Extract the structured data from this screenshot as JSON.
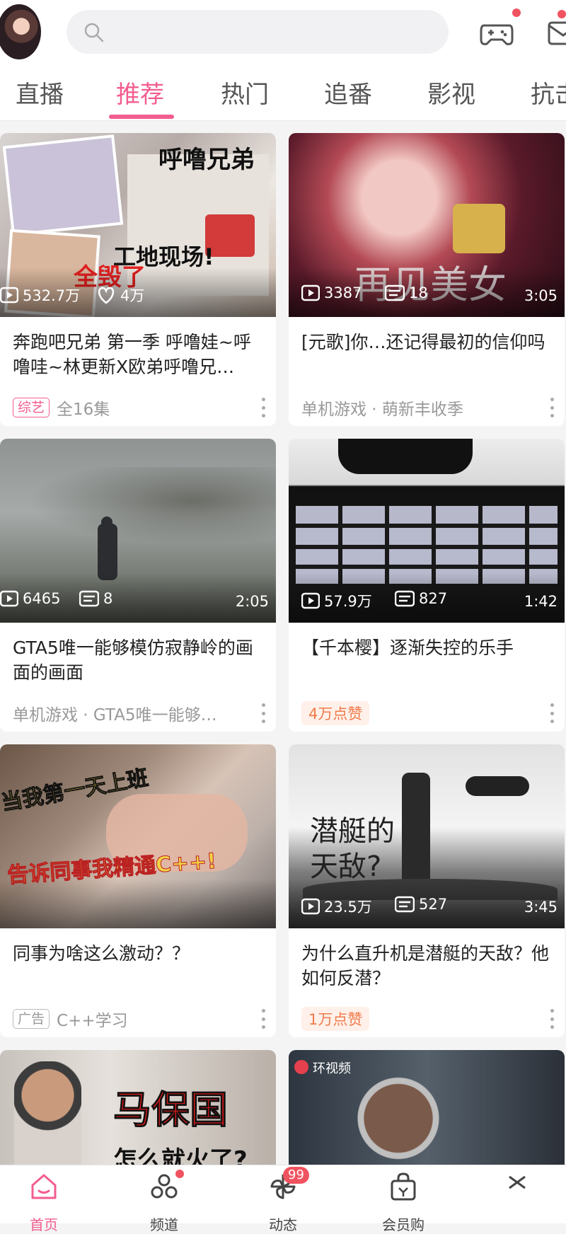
{
  "colors": {
    "accent": "#f25d8e",
    "bg": "#f4f4f4",
    "red_dot": "#f0535f"
  },
  "header": {
    "avatar": "user-avatar",
    "search_placeholder": "",
    "icons": [
      "game-controller-icon",
      "mail-icon"
    ]
  },
  "tabs": [
    "直播",
    "推荐",
    "热门",
    "追番",
    "影视",
    "抗击"
  ],
  "active_tab": "推荐",
  "cards": [
    {
      "thumb_text": [
        "呼噜兄弟",
        "工地现场!",
        "全毁了"
      ],
      "play_count": "532.7万",
      "second_stat": "4万",
      "duration": "",
      "title": "奔跑吧兄弟 第一季 呼噜娃~呼噜哇~林更新X欧弟呼噜兄…",
      "badge": "综艺",
      "meta": "全16集"
    },
    {
      "thumb_text": [
        "再见美女"
      ],
      "play_count": "3387",
      "second_stat": "18",
      "duration": "3:05",
      "title": "[元歌]你…还记得最初的信仰吗",
      "meta": "单机游戏 · 萌新丰收季"
    },
    {
      "play_count": "6465",
      "second_stat": "8",
      "duration": "2:05",
      "title": "GTA5唯一能够模仿寂静岭的画面的画面",
      "meta": "单机游戏 · GTA5唯一能够…"
    },
    {
      "play_count": "57.9万",
      "second_stat": "827",
      "duration": "1:42",
      "title": "【千本樱】逐渐失控的乐手",
      "pill": "4万点赞"
    },
    {
      "thumb_text": [
        "当我第一天上班",
        "告诉同事我精通C++!"
      ],
      "title": "同事为啥这么激动？？",
      "badge": "广告",
      "meta": "C++学习"
    },
    {
      "thumb_text": [
        "潜艇的",
        "天敌?"
      ],
      "play_count": "23.5万",
      "second_stat": "527",
      "duration": "3:45",
      "title": "为什么直升机是潜艇的天敌？他如何反潜？",
      "pill": "1万点赞"
    },
    {
      "thumb_text": [
        "马保国",
        "怎么就火了?"
      ]
    },
    {
      "thumb_text": [
        "环视频"
      ]
    }
  ],
  "bottom_nav": [
    {
      "label": "首页",
      "icon": "home-icon"
    },
    {
      "label": "频道",
      "icon": "channel-icon"
    },
    {
      "label": "动态",
      "icon": "pinwheel-icon",
      "badge": "99"
    },
    {
      "label": "会员购",
      "icon": "shopping-bag-icon"
    }
  ]
}
